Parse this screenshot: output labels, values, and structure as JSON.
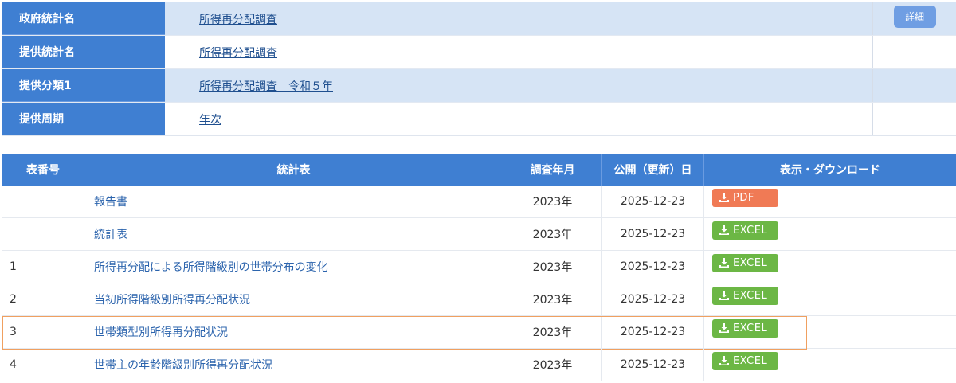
{
  "info": {
    "rows": [
      {
        "label": "政府統計名",
        "value": "所得再分配調査"
      },
      {
        "label": "提供統計名",
        "value": "所得再分配調査"
      },
      {
        "label": "提供分類1",
        "value": "所得再分配調査　令和５年"
      },
      {
        "label": "提供周期",
        "value": "年次"
      }
    ],
    "detail_button": "詳細"
  },
  "table": {
    "headers": [
      "表番号",
      "統計表",
      "調査年月",
      "公開（更新）日",
      "表示・ダウンロード"
    ],
    "rows": [
      {
        "no": "",
        "title": "報告書",
        "survey": "2023年",
        "published": "2025-12-23",
        "download": "PDF"
      },
      {
        "no": "",
        "title": "統計表",
        "survey": "2023年",
        "published": "2025-12-23",
        "download": "EXCEL"
      },
      {
        "no": "1",
        "title": "所得再分配による所得階級別の世帯分布の変化",
        "survey": "2023年",
        "published": "2025-12-23",
        "download": "EXCEL"
      },
      {
        "no": "2",
        "title": "当初所得階級別所得再分配状況",
        "survey": "2023年",
        "published": "2025-12-23",
        "download": "EXCEL"
      },
      {
        "no": "3",
        "title": "世帯類型別所得再分配状況",
        "survey": "2023年",
        "published": "2025-12-23",
        "download": "EXCEL"
      },
      {
        "no": "4",
        "title": "世帯主の年齢階級別所得再分配状況",
        "survey": "2023年",
        "published": "2025-12-23",
        "download": "EXCEL"
      }
    ]
  },
  "colors": {
    "header_blue": "#3f7fd2",
    "shade_blue": "#d6e4f5",
    "pdf_orange": "#f07a55",
    "excel_green": "#6cb745",
    "highlight_orange": "#f0a060"
  },
  "icons": {
    "download": "download-icon"
  }
}
